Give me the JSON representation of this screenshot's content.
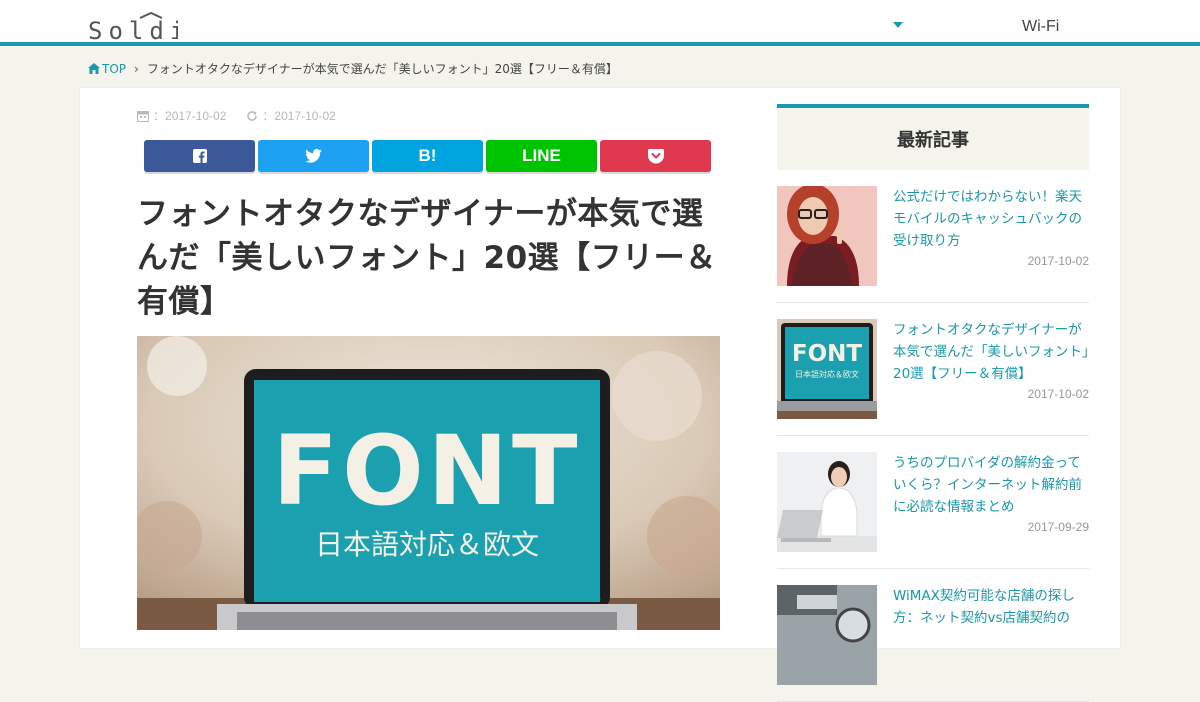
{
  "header": {
    "logo_text": "Soldi",
    "nav_item": "Wi-Fi"
  },
  "breadcrumb": {
    "home": "TOP",
    "current": "フォントオタクなデザイナーが本気で選んだ「美しいフォント」20選【フリー＆有償】"
  },
  "article": {
    "published": "2017-10-02",
    "updated": "2017-10-02",
    "share": {
      "facebook_icon": "facebook-icon",
      "twitter_icon": "twitter-icon",
      "hatena_label": "B!",
      "line_label": "LINE",
      "pocket_icon": "pocket-icon"
    },
    "title": "フォントオタクなデザイナーが本気で選んだ「美しいフォント」20選【フリー＆有償】",
    "hero": {
      "big_text": "FONT",
      "sub_text": "日本語対応＆欧文"
    }
  },
  "sidebar": {
    "heading": "最新記事",
    "items": [
      {
        "title": "公式だけではわからない！楽天モバイルのキャッシュバックの受け取り方",
        "date": "2017-10-02"
      },
      {
        "title": "フォントオタクなデザイナーが本気で選んだ「美しいフォント」20選【フリー＆有償】",
        "date": "2017-10-02",
        "thumb_big": "FONT",
        "thumb_sub": "日本語対応＆欧文"
      },
      {
        "title": "うちのプロバイダの解約金っていくら？インターネット解約前に必読な情報まとめ",
        "date": "2017-09-29"
      },
      {
        "title": "WiMAX契約可能な店舗の探し方：ネット契約vs店舗契約の",
        "date": ""
      }
    ]
  },
  "colors": {
    "accent": "#1a99aa",
    "background": "#f5f4ec",
    "facebook": "#3b5998",
    "twitter": "#1da1f2",
    "hatena": "#00a4de",
    "line": "#00c300",
    "pocket": "#e0394f"
  }
}
